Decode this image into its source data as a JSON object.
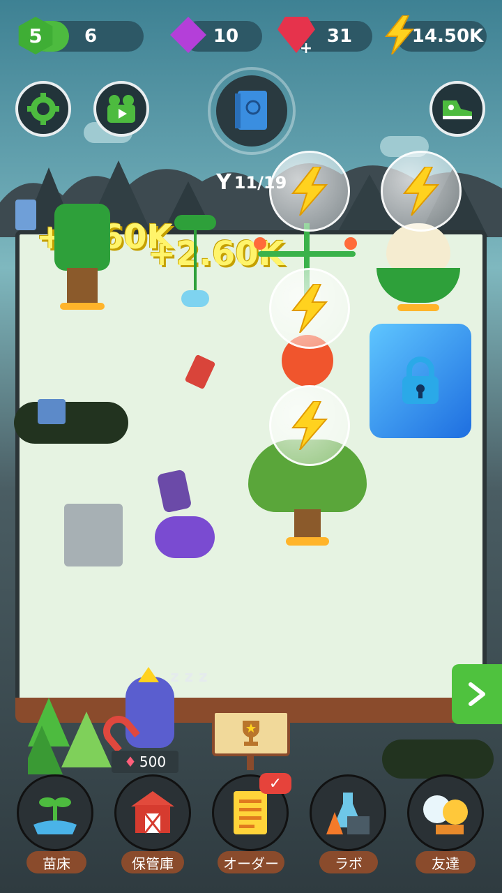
{
  "hud": {
    "level": "5",
    "xp": "6",
    "gems_purple": "10",
    "gems_red": "31",
    "energy": "14.50K"
  },
  "collection": {
    "progress": "11/19",
    "book_icon": "plant-book-icon"
  },
  "floating_rewards": [
    "+2.60K",
    "+2.60K"
  ],
  "magnet": {
    "price": "500"
  },
  "nav": [
    {
      "label": "苗床",
      "icon": "sprout-icon"
    },
    {
      "label": "保管庫",
      "icon": "barn-icon"
    },
    {
      "label": "オーダー",
      "icon": "order-scroll-icon",
      "badge": "check-icon"
    },
    {
      "label": "ラボ",
      "icon": "lab-icon"
    },
    {
      "label": "友達",
      "icon": "friends-icon"
    }
  ],
  "colors": {
    "accent_green": "#4dbb3f",
    "board": "#e6f3e2",
    "nav_label": "#8a4b2c",
    "energy": "#ffd21f"
  }
}
